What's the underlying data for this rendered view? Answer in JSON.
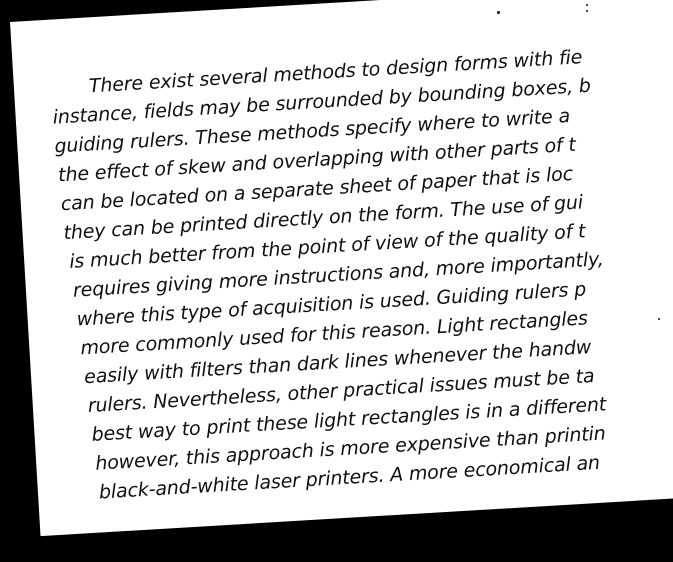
{
  "document": {
    "lines": [
      "There exist several methods to design forms with fie",
      "instance, fields may be surrounded by bounding boxes, b",
      "guiding rulers. These methods specify where to write a",
      "the effect of skew and overlapping with other parts of t",
      "can be located on a separate sheet of paper that is loc",
      "they can be printed directly on the form. The use of gui",
      "is much better from the point of view of the quality of t",
      "requires giving more instructions and, more importantly,",
      "where this type of acquisition is used. Guiding rulers p",
      "more commonly used for this reason. Light rectangles",
      "easily with filters than dark lines whenever the handw",
      "rulers. Nevertheless, other practical issues must be ta",
      "best way to print these light rectangles is in a different",
      "however, this approach is more expensive than printin",
      "black-and-white laser printers. A more economical an"
    ]
  }
}
